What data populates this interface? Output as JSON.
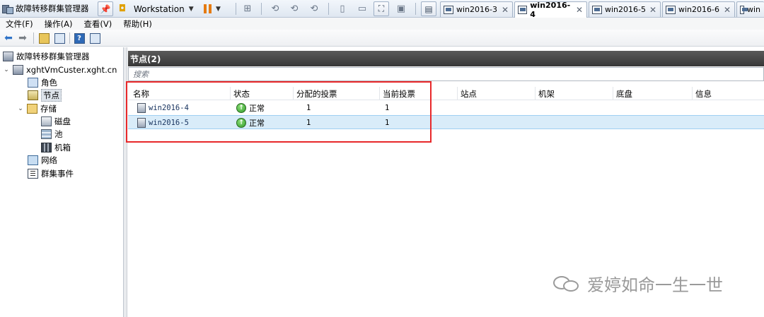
{
  "window": {
    "title": "故障转移群集管理器"
  },
  "vmware": {
    "vm_name": "Workstation",
    "tabs": [
      {
        "label": "win2016-3",
        "active": false
      },
      {
        "label": "win2016-4",
        "active": true
      },
      {
        "label": "win2016-5",
        "active": false
      },
      {
        "label": "win2016-6",
        "active": false
      },
      {
        "label": "win",
        "active": false
      }
    ],
    "close_glyph": "✕"
  },
  "menu": [
    "文件(F)",
    "操作(A)",
    "查看(V)",
    "帮助(H)"
  ],
  "tree": {
    "root": "故障转移群集管理器",
    "cluster": "xghtVmCuster.xght.cn",
    "items": [
      {
        "label": "角色",
        "icon": "roles-icon"
      },
      {
        "label": "节点",
        "icon": "nodes-icon"
      },
      {
        "label": "存储",
        "icon": "storage-icon"
      },
      {
        "label": "磁盘",
        "icon": "disk-icon"
      },
      {
        "label": "池",
        "icon": "pool-icon"
      },
      {
        "label": "机箱",
        "icon": "enclosure-icon"
      },
      {
        "label": "网络",
        "icon": "network-icon"
      },
      {
        "label": "群集事件",
        "icon": "events-icon"
      }
    ]
  },
  "content": {
    "header": "节点(2)",
    "search_placeholder": "搜索",
    "columns": [
      "名称",
      "状态",
      "分配的投票",
      "当前投票",
      "站点",
      "机架",
      "底盘",
      "信息"
    ],
    "rows": [
      {
        "name": "win2016-4",
        "status": "正常",
        "assigned_vote": "1",
        "current_vote": "1",
        "selected": false
      },
      {
        "name": "win2016-5",
        "status": "正常",
        "assigned_vote": "1",
        "current_vote": "1",
        "selected": true
      }
    ]
  },
  "watermark": {
    "text": "爱婷如命一生一世"
  },
  "colors": {
    "highlight": "#e8282a",
    "header_bg": "#3f3f3f",
    "selection": "#d9ecf9"
  }
}
